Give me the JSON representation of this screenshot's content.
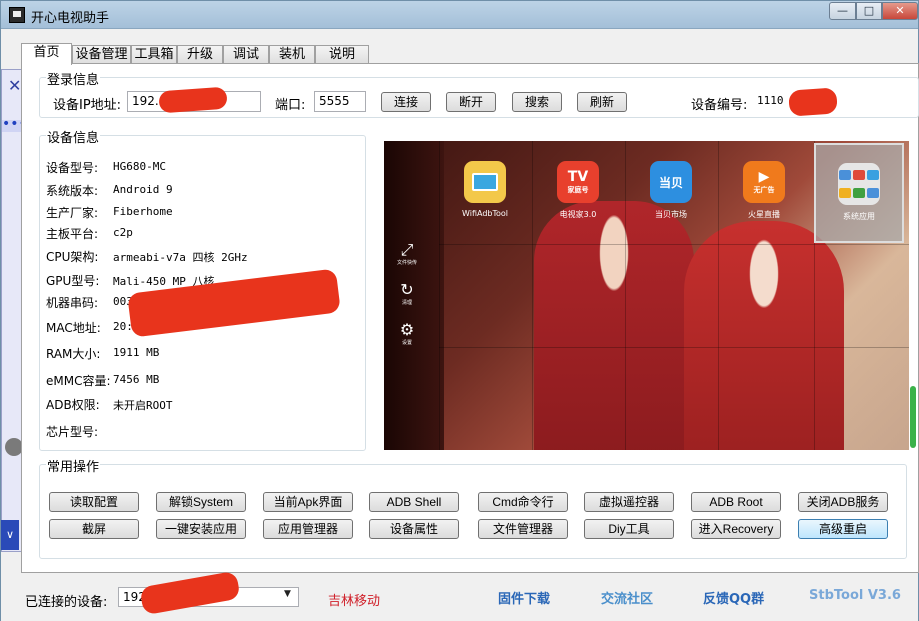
{
  "window": {
    "title": "开心电视助手",
    "min_label": "—",
    "max_label": "□",
    "close_label": "✕"
  },
  "tabs": [
    "首页",
    "设备管理",
    "工具箱",
    "升级",
    "调试",
    "装机",
    "说明"
  ],
  "login": {
    "title": "登录信息",
    "ip_label": "设备IP地址:",
    "ip_value": "192.",
    "port_label": "端口:",
    "port_value": "5555",
    "buttons": [
      "连接",
      "断开",
      "搜索",
      "刷新"
    ],
    "device_no_label": "设备编号:",
    "device_no_value": "1110"
  },
  "device_info": {
    "title": "设备信息",
    "rows": [
      {
        "label": "设备型号:",
        "value": "HG680-MC"
      },
      {
        "label": "系统版本:",
        "value": "Android 9"
      },
      {
        "label": "生产厂家:",
        "value": "Fiberhome"
      },
      {
        "label": "主板平台:",
        "value": "c2p"
      },
      {
        "label": "CPU架构:",
        "value": "armeabi-v7a 四核 2GHz"
      },
      {
        "label": "GPU型号:",
        "value": "Mali-450 MP 八核"
      },
      {
        "label": "机器串码:",
        "value": "00380300"
      },
      {
        "label": "MAC地址:",
        "value": "20:          :1D:16"
      },
      {
        "label": "RAM大小:",
        "value": "1911 MB"
      },
      {
        "label": "eMMC容量:",
        "value": "7456 MB"
      },
      {
        "label": "ADB权限:",
        "value": "未开启ROOT"
      },
      {
        "label": "芯片型号:",
        "value": ""
      }
    ]
  },
  "preview": {
    "apps": [
      {
        "name": "WifiAdbTool",
        "icon": "wifi-adb-tool-icon",
        "badge": "",
        "color": "#f3c84a"
      },
      {
        "name": "电视家3.0",
        "icon": "tv-home-icon",
        "badge": "家庭号",
        "color": "#e8402d"
      },
      {
        "name": "当贝市场",
        "icon": "dangbei-market-icon",
        "badge": "当贝",
        "color": "#2d8fe0"
      },
      {
        "name": "火星直播",
        "icon": "mars-live-icon",
        "badge": "无广告",
        "color": "#f07a1c"
      },
      {
        "name": "系统应用",
        "icon": "system-apps-icon",
        "badge": "",
        "color": "#d8d8d8"
      }
    ],
    "side": [
      {
        "label": "文件快传",
        "icon": "file-transfer-icon",
        "glyph": "⤢"
      },
      {
        "label": "清理",
        "icon": "clean-icon",
        "glyph": "↻"
      },
      {
        "label": "设置",
        "icon": "settings-gear-icon",
        "glyph": "⚙"
      }
    ]
  },
  "ops": {
    "title": "常用操作",
    "row1": [
      "读取配置",
      "解锁System",
      "当前Apk界面",
      "ADB Shell",
      "Cmd命令行",
      "虚拟遥控器",
      "ADB  Root",
      "关闭ADB服务"
    ],
    "row2": [
      "截屏",
      "一键安装应用",
      "应用管理器",
      "设备属性",
      "文件管理器",
      "Diy工具",
      "进入Recovery",
      "高级重启"
    ]
  },
  "status": {
    "connected_label": "已连接的设备:",
    "connected_value": "192.",
    "carrier": "吉林移动",
    "links": [
      "固件下载",
      "交流社区",
      "反馈QQ群"
    ],
    "version": "StbTool V3.6"
  }
}
